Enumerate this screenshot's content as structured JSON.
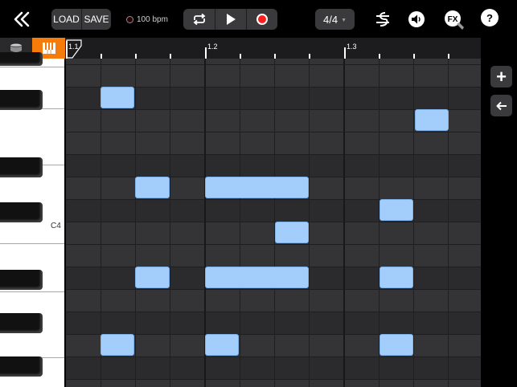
{
  "toolbar": {
    "back_icon": "double-chevron-left-icon",
    "load_label": "LOAD",
    "save_label": "SAVE",
    "bpm_label": "100 bpm",
    "loop_icon": "loop-icon",
    "play_icon": "play-icon",
    "record_icon": "record-icon",
    "record_color": "#ff1e1e",
    "time_signature": "4/4",
    "mixer_icon": "sliders-icon",
    "volume_icon": "speaker-icon",
    "fx_label": "FX",
    "help_label": "?"
  },
  "tabs": {
    "drum_icon": "drum-icon",
    "keys_icon": "piano-keys-icon",
    "active_color": "#f57c0a"
  },
  "ruler": {
    "labels": [
      "1.1",
      "1.2",
      "1.3"
    ]
  },
  "piano": {
    "c4_label": "C4"
  },
  "side": {
    "add_label": "+",
    "back_icon": "arrow-left-icon"
  },
  "colors": {
    "note": "#a3cdfb",
    "grid": "#343436",
    "toolbar_button": "#3a3a3c"
  }
}
